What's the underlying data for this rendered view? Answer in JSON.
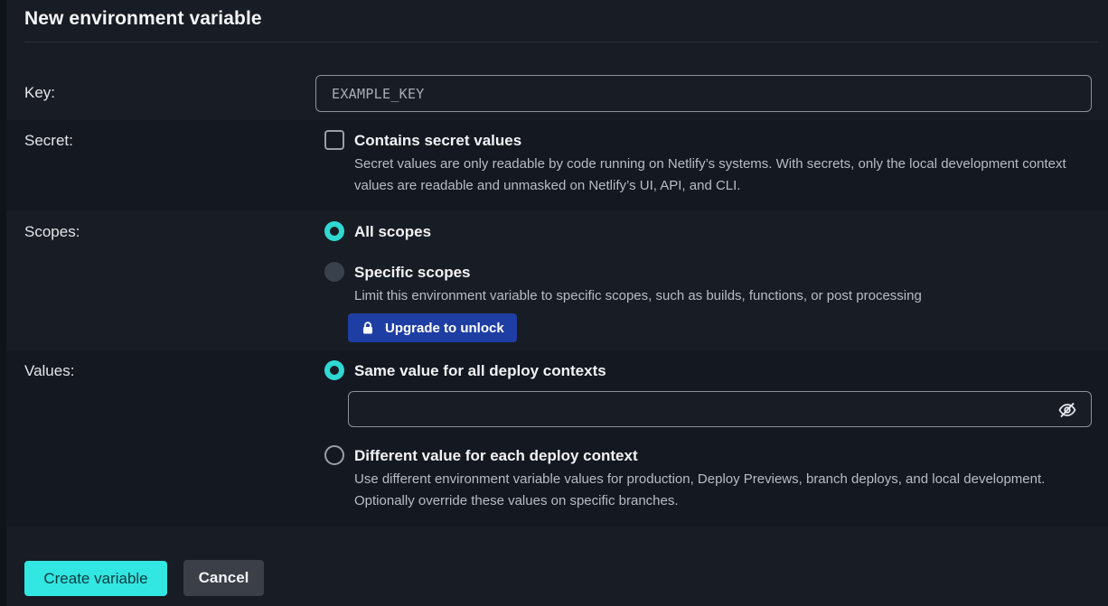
{
  "form": {
    "title": "New environment variable"
  },
  "key": {
    "label": "Key:",
    "placeholder": "EXAMPLE_KEY"
  },
  "secret": {
    "label": "Secret:",
    "checkbox_label": "Contains secret values",
    "checked": false,
    "description": "Secret values are only readable by code running on Netlify’s systems. With secrets, only the local development context values are readable and unmasked on Netlify’s UI, API, and CLI."
  },
  "scopes": {
    "label": "Scopes:",
    "options": [
      {
        "label": "All scopes",
        "selected": true
      },
      {
        "label": "Specific scopes",
        "selected": false,
        "disabled": true,
        "description": "Limit this environment variable to specific scopes, such as builds, functions, or post processing"
      }
    ],
    "upgrade_button": "Upgrade to unlock"
  },
  "values": {
    "label": "Values:",
    "options": [
      {
        "label": "Same value for all deploy contexts",
        "selected": true
      },
      {
        "label": "Different value for each deploy context",
        "selected": false,
        "description": "Use different environment variable values for production, Deploy Previews, branch deploys, and local development. Optionally override these values on specific branches."
      }
    ],
    "value_input": "",
    "visibility_icon": "eye-off-icon"
  },
  "actions": {
    "create_label": "Create variable",
    "cancel_label": "Cancel"
  },
  "colors": {
    "accent": "#32e6e2",
    "upgrade": "#1f3ea3",
    "background": "#181c24"
  }
}
